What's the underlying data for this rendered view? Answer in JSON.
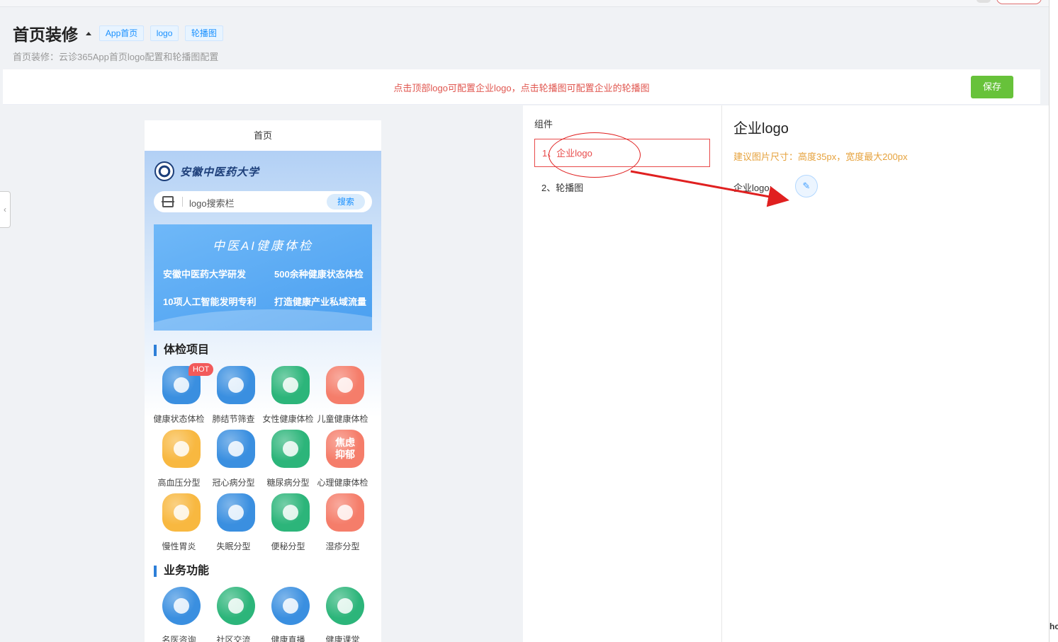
{
  "header": {
    "title": "首页装修",
    "tags": [
      "App首页",
      "logo",
      "轮播图"
    ],
    "subtitle": "首页装修：云诊365App首页logo配置和轮播图配置"
  },
  "notice": {
    "text": "点击顶部logo可配置企业logo，点击轮播图可配置企业的轮播图",
    "save_label": "保存"
  },
  "phone": {
    "title": "首页",
    "university_name": "安徽中医药大学",
    "search_placeholder": "logo搜索栏",
    "search_button": "搜索",
    "banner": {
      "title": "中医AI健康体检",
      "lines": [
        "安徽中医药大学研发",
        "500余种健康状态体检",
        "10项人工智能发明专利",
        "打造健康产业私域流量"
      ]
    },
    "sections": [
      {
        "title": "体检项目",
        "items": [
          {
            "label": "健康状态体检",
            "icon": "doctor-plus-icon",
            "color": "#3a8fe0",
            "hot": "HOT"
          },
          {
            "label": "肺结节筛查",
            "icon": "lungs-icon",
            "color": "#3a8fe0"
          },
          {
            "label": "女性健康体检",
            "icon": "woman-icon",
            "color": "#2cb57a"
          },
          {
            "label": "儿童健康体检",
            "icon": "child-icon",
            "color": "#f57d6a"
          },
          {
            "label": "高血压分型",
            "icon": "stethoscope-icon",
            "color": "#f8b840"
          },
          {
            "label": "冠心病分型",
            "icon": "heart-icon",
            "color": "#3a8fe0"
          },
          {
            "label": "糖尿病分型",
            "icon": "drops-icon",
            "color": "#2cb57a"
          },
          {
            "label": "心理健康体检",
            "icon": "anxiety-text-icon",
            "color": "#f57d6a",
            "glyph": "焦虑\n抑郁"
          },
          {
            "label": "慢性胃炎",
            "icon": "stomach-icon",
            "color": "#f8b840"
          },
          {
            "label": "失眠分型",
            "icon": "bed-icon",
            "color": "#3a8fe0"
          },
          {
            "label": "便秘分型",
            "icon": "toilet-icon",
            "color": "#2cb57a"
          },
          {
            "label": "湿疹分型",
            "icon": "hand-icon",
            "color": "#f57d6a"
          }
        ]
      },
      {
        "title": "业务功能",
        "items": [
          {
            "label": "名医咨询",
            "icon": "doctor-icon",
            "color": "#3a8fe0"
          },
          {
            "label": "社区交流",
            "icon": "community-icon",
            "color": "#2cb57a"
          },
          {
            "label": "健康直播",
            "icon": "video-icon",
            "color": "#3a8fe0"
          },
          {
            "label": "健康课堂",
            "icon": "book-icon",
            "color": "#2cb57a"
          }
        ]
      }
    ]
  },
  "components": {
    "heading": "组件",
    "items": [
      "1、企业logo",
      "2、轮播图"
    ]
  },
  "config": {
    "title": "企业logo",
    "hint": "建议图片尺寸：高度35px，宽度最大200px",
    "field_label": "企业logo:"
  },
  "right_edge_text": "hc"
}
